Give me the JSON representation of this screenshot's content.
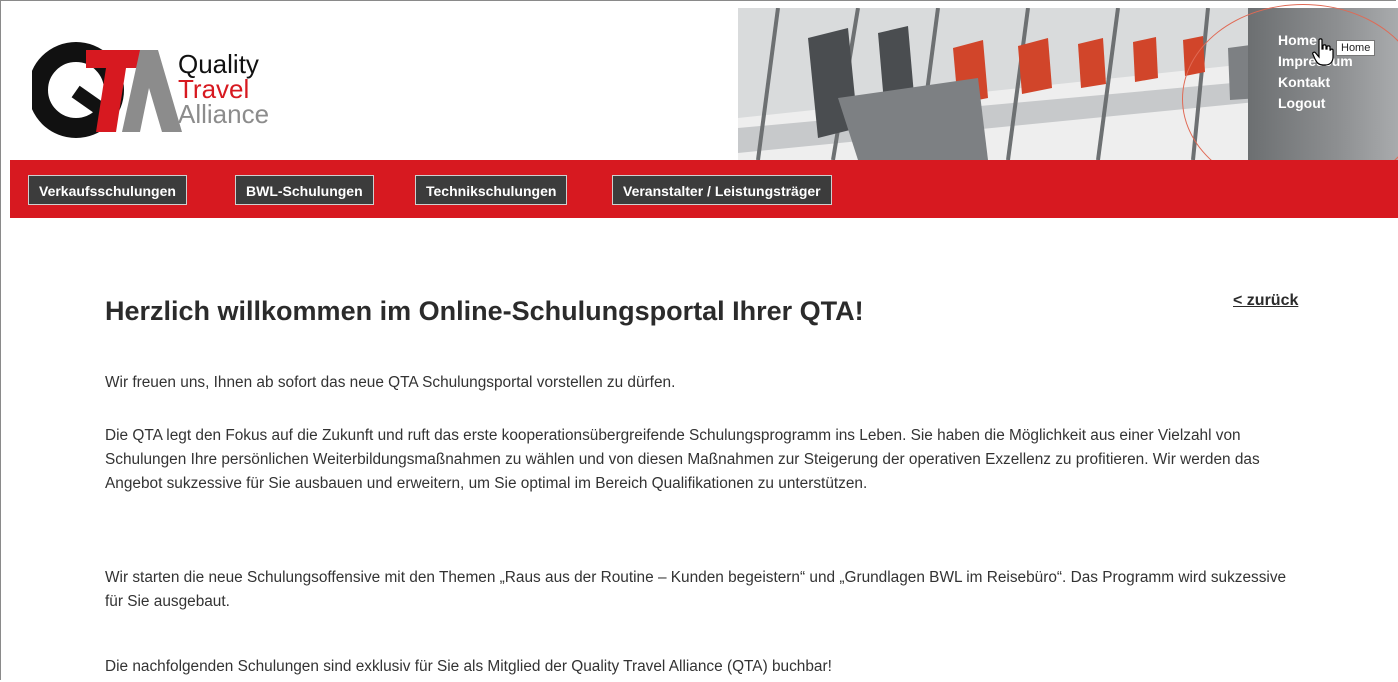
{
  "logo": {
    "mark": "QTA",
    "line1": "Quality",
    "line2": "Travel",
    "line3": "Alliance"
  },
  "topnav": {
    "items": [
      "Home",
      "Impressum",
      "Kontakt",
      "Logout"
    ],
    "tooltip": "Home"
  },
  "mainnav": {
    "items": [
      "Verkaufsschulungen",
      "BWL-Schulungen",
      "Technikschulungen",
      "Veranstalter / Leistungsträger"
    ]
  },
  "content": {
    "title": "Herzlich willkommen im Online-Schulungsportal Ihrer QTA!",
    "back_link": "< zurück",
    "paragraphs": [
      "Wir freuen uns, Ihnen ab sofort das neue QTA Schulungsportal vorstellen zu dürfen.",
      "Die QTA legt den Fokus auf die Zukunft und ruft das erste kooperationsübergreifende Schulungsprogramm ins Leben. Sie haben die Möglichkeit aus einer Vielzahl von Schulungen Ihre persönlichen Weiterbildungsmaßnahmen zu wählen und von diesen Maßnahmen zur Steigerung der operativen Exzellenz zu profitieren. Wir werden das Angebot sukzessive für Sie ausbauen und erweitern, um Sie optimal im Bereich Qualifikationen zu unterstützen.",
      "Wir starten die neue Schulungsoffensive mit den Themen „Raus aus der Routine – Kunden begeistern“ und „Grundlagen BWL im Reisebüro“. Das Programm wird sukzessive für Sie ausgebaut.",
      "Die nachfolgenden Schulungen sind exklusiv für Sie als Mitglied der Quality Travel Alliance (QTA) buchbar!"
    ]
  },
  "colors": {
    "brand_red": "#d71920",
    "nav_button_bg": "#3c3c3c",
    "logo_grey": "#8c8c8c",
    "text": "#333333"
  }
}
